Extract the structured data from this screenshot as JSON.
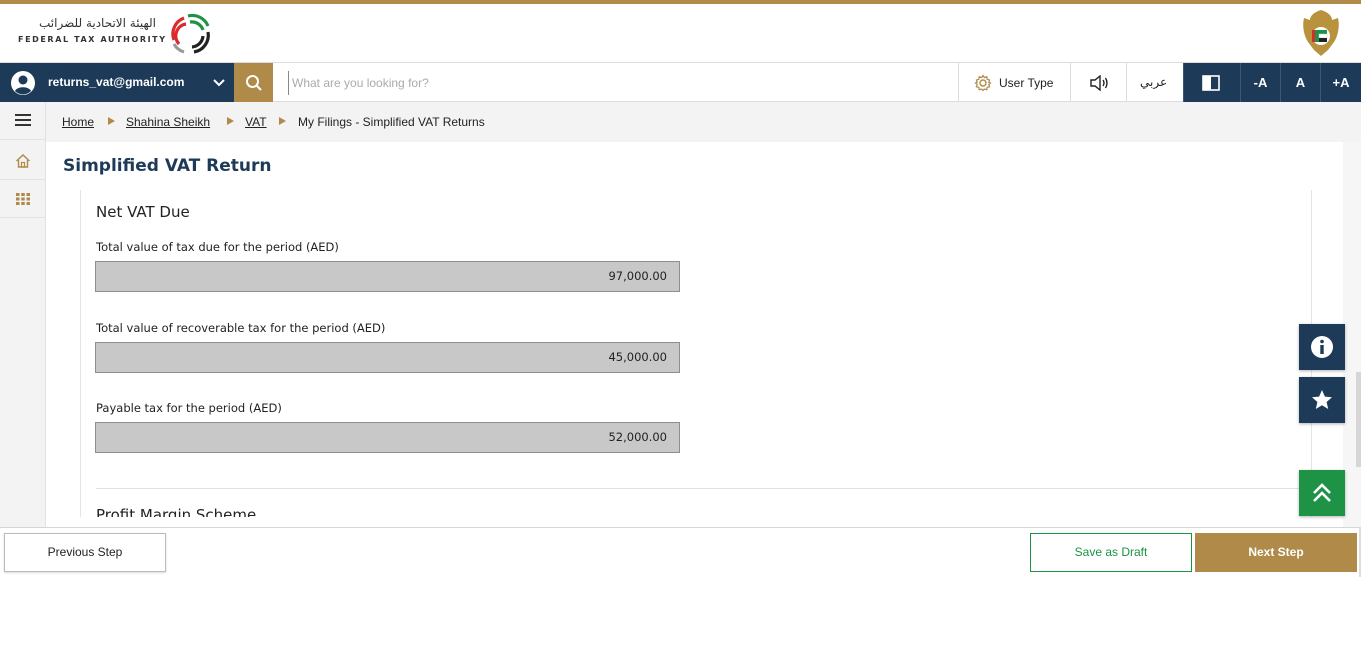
{
  "logo": {
    "arabic_text": "الهيئة الاتحادية للضرائب",
    "english_text": "FEDERAL TAX AUTHORITY"
  },
  "colors": {
    "navy": "#1d3a58",
    "gold": "#b08a48",
    "green": "#1e9245",
    "field_gray": "#c8c8c8"
  },
  "navbar": {
    "user_email": "returns_vat@gmail.com",
    "search_placeholder": "What are you looking for?",
    "user_type_label": "User Type",
    "language_label": "عربي",
    "font_decrease_label": "-A",
    "font_normal_label": "A",
    "font_increase_label": "+A",
    "icons": [
      "user-avatar-icon",
      "chevron-down-icon",
      "search-icon",
      "gear-icon",
      "speaker-icon",
      "contrast-icon"
    ]
  },
  "sidebar": {
    "icons": [
      "menu-icon",
      "home-icon",
      "apps-grid-icon"
    ]
  },
  "breadcrumb": {
    "items": [
      {
        "label": "Home"
      },
      {
        "label": "Shahina Sheikh"
      },
      {
        "label": "VAT"
      },
      {
        "label": "My Filings - Simplified VAT Returns"
      }
    ]
  },
  "main": {
    "page_title": "Simplified VAT Return",
    "section_title": "Net VAT Due",
    "fields": [
      {
        "label": "Total value of tax due for the period (AED)",
        "value": "97,000.00"
      },
      {
        "label": "Total value of recoverable tax for the period (AED)",
        "value": "45,000.00"
      },
      {
        "label": "Payable tax for the period (AED)",
        "value": "52,000.00"
      }
    ],
    "next_section_title": "Profit Margin Scheme"
  },
  "floating": {
    "icons": [
      "info-icon",
      "star-icon",
      "double-chevron-up-icon"
    ]
  },
  "footer": {
    "previous_label": "Previous Step",
    "draft_label": "Save as Draft",
    "next_label": "Next Step"
  }
}
